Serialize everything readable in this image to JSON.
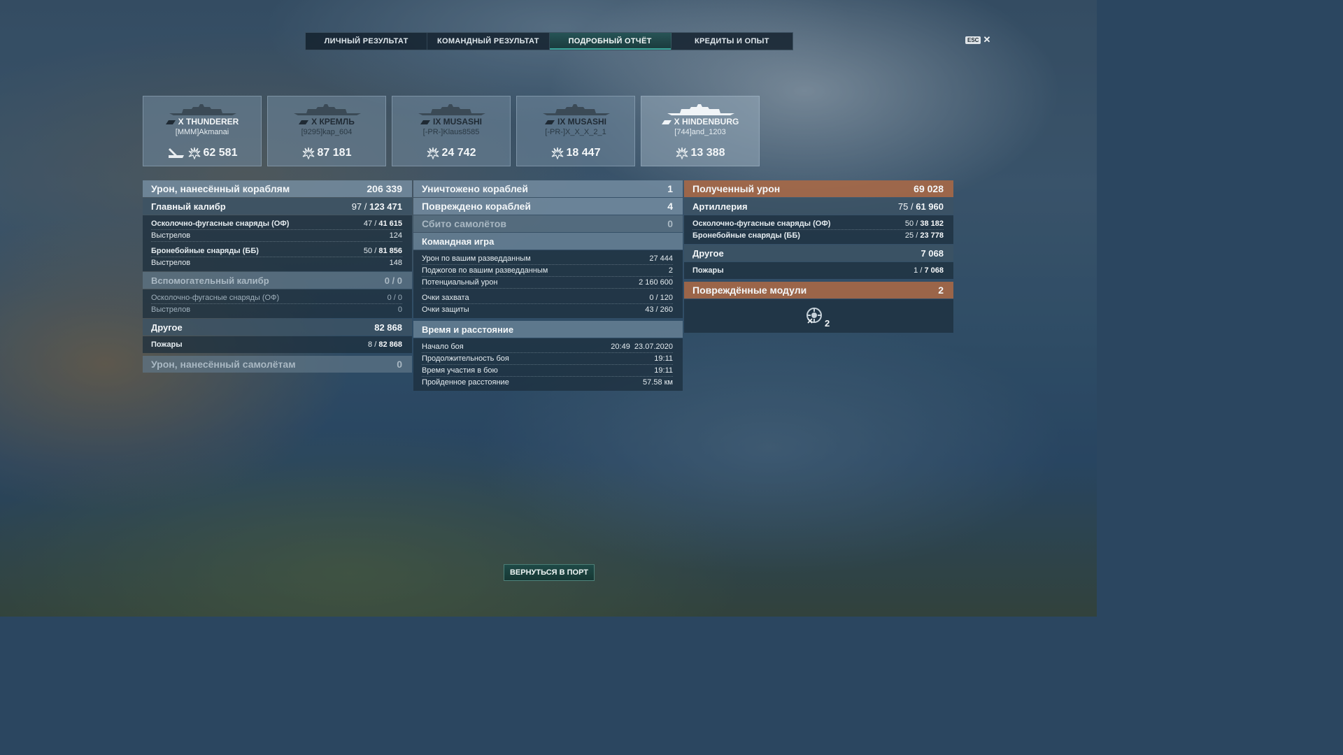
{
  "tabs": [
    {
      "label": "ЛИЧНЫЙ РЕЗУЛЬТАТ"
    },
    {
      "label": "КОМАНДНЫЙ РЕЗУЛЬТАТ"
    },
    {
      "label": "ПОДРОБНЫЙ ОТЧЁТ",
      "active": true
    },
    {
      "label": "КРЕДИТЫ И ОПЫТ"
    }
  ],
  "esc_label": "ESC",
  "ships": [
    {
      "name": "X THUNDERER",
      "player": "[MMM]Akmanai",
      "damage": "62 581",
      "highlight": true
    },
    {
      "name": "X КРЕМЛЬ",
      "player": "[9295]kap_604",
      "damage": "87 181"
    },
    {
      "name": "IX MUSASHI",
      "player": "[-PR-]Klaus8585",
      "damage": "24 742"
    },
    {
      "name": "IX MUSASHI",
      "player": "[-PR-]X_X_X_2_1",
      "damage": "18 447"
    },
    {
      "name": "X HINDENBURG",
      "player": "[744]and_1203",
      "damage": "13 388",
      "highlight": true
    }
  ],
  "left": {
    "ship_damage": {
      "label": "Урон, нанесённый кораблям",
      "value": "206 339"
    },
    "main_battery": {
      "label": "Главный калибр",
      "hits": "97",
      "value": "123 471"
    },
    "he": {
      "label": "Осколочно-фугасные снаряды (ОФ)",
      "hits": "47",
      "value": "41 615",
      "shots_label": "Выстрелов",
      "shots": "124"
    },
    "ap": {
      "label": "Бронебойные снаряды (ББ)",
      "hits": "50",
      "value": "81 856",
      "shots_label": "Выстрелов",
      "shots": "148"
    },
    "secondary": {
      "label": "Вспомогательный калибр",
      "value": "0 / 0",
      "he_label": "Осколочно-фугасные снаряды (ОФ)",
      "he_value": "0 / 0",
      "shots_label": "Выстрелов",
      "shots": "0"
    },
    "other": {
      "label": "Другое",
      "value": "82 868",
      "fires_label": "Пожары",
      "fires_count": "8",
      "fires_value": "82 868"
    },
    "plane_damage": {
      "label": "Урон, нанесённый самолётам",
      "value": "0"
    }
  },
  "middle": {
    "destroyed": {
      "label": "Уничтожено кораблей",
      "value": "1"
    },
    "damaged": {
      "label": "Повреждено кораблей",
      "value": "4"
    },
    "planes": {
      "label": "Сбито самолётов",
      "value": "0"
    },
    "team_play": {
      "label": "Командная игра",
      "rows": [
        {
          "label": "Урон по вашим разведданным",
          "value": "27 444"
        },
        {
          "label": "Поджогов по вашим разведданным",
          "value": "2"
        },
        {
          "label": "Потенциальный урон",
          "value": "2 160 600"
        },
        {
          "label": "Очки захвата",
          "value": "0 / 120"
        },
        {
          "label": "Очки защиты",
          "value": "43 / 260"
        }
      ]
    },
    "time": {
      "label": "Время и расстояние",
      "rows": [
        {
          "label": "Начало боя",
          "value": "20:49  23.07.2020"
        },
        {
          "label": "Продолжительность боя",
          "value": "19:11"
        },
        {
          "label": "Время участия в бою",
          "value": "19:11"
        },
        {
          "label": "Пройденное расстояние",
          "value": "57.58 км"
        }
      ]
    }
  },
  "right": {
    "received": {
      "label": "Полученный урон",
      "value": "69 028"
    },
    "artillery": {
      "label": "Артиллерия",
      "hits": "75",
      "value": "61 960"
    },
    "he": {
      "label": "Осколочно-фугасные снаряды (ОФ)",
      "hits": "50",
      "value": "38 182"
    },
    "ap": {
      "label": "Бронебойные снаряды (ББ)",
      "hits": "25",
      "value": "23 778"
    },
    "other": {
      "label": "Другое",
      "value": "7 068",
      "fires_label": "Пожары",
      "fires_count": "1",
      "fires_value": "7 068"
    },
    "modules": {
      "label": "Повреждённые модули",
      "value": "2",
      "count": "2",
      "icon": "module-damage-icon"
    }
  },
  "return_button": "ВЕРНУТЬСЯ В ПОРТ"
}
